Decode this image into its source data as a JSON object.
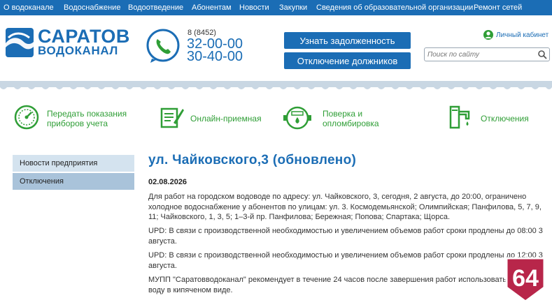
{
  "nav": {
    "items": [
      "О водоканале",
      "Водоснабжение",
      "Водоотведение",
      "Абонентам",
      "Новости",
      "Закупки",
      "Сведения об образовательной организации",
      "Ремонт сетей"
    ]
  },
  "logo": {
    "line1": "САРАТОВ",
    "line2": "ВОДОКАНАЛ",
    "icon": "wave-logo-icon"
  },
  "phone": {
    "code": "8 (8452)",
    "number1": "32-00-00",
    "number2": "30-40-00",
    "icon": "phone-icon"
  },
  "buttons": {
    "debt": "Узнать задолженность",
    "disconnect_debtors": "Отключение должников"
  },
  "cabinet": {
    "label": "Личный кабинет",
    "icon": "user-icon"
  },
  "search": {
    "placeholder": "Поиск по сайту",
    "icon": "search-icon"
  },
  "features": [
    {
      "label_line1": "Передать показания",
      "label_line2": "приборов учета",
      "icon": "meter-gauge-icon"
    },
    {
      "label_line1": "Онлайн-приемная",
      "label_line2": "",
      "icon": "document-pen-icon"
    },
    {
      "label_line1": "Поверка и",
      "label_line2": "опломбировка",
      "icon": "water-meter-icon"
    },
    {
      "label_line1": "Отключения",
      "label_line2": "",
      "icon": "faucet-icon"
    }
  ],
  "sidebar": {
    "items": [
      {
        "label": "Новости предприятия"
      },
      {
        "label": "Отключения"
      }
    ]
  },
  "article": {
    "title": "ул. Чайковского,3 (обновлено)",
    "date": "02.08.2026",
    "paragraphs": [
      "Для работ на городском водоводе по адресу: ул. Чайковского, 3, сегодня, 2 августа, до 20:00, ограничено холодное водоснабжение у абонентов по улицам: ул. 3. Космодемьянской; Олимпийская; Панфилова, 5, 7, 9, 11; Чайковского, 1, 3, 5; 1–3-й пр. Панфилова; Бережная; Попова; Спартака; Щорса.",
      "UPD: В связи с производственной необходимостью и увеличением объемов работ сроки продлены до 08:00 3 августа.",
      "UPD: В связи с производственной необходимостью и увеличением объемов работ сроки продлены до 12:00 3 августа.",
      "МУПП \"Саратовводоканал\" рекомендует в течение 24 часов после завершения работ использовать питьевую воду в кипяченом виде."
    ]
  },
  "badge": {
    "text": "64"
  },
  "colors": {
    "brand_blue": "#1b6db5",
    "green": "#2f9e36",
    "badge_red": "#b8264a"
  }
}
